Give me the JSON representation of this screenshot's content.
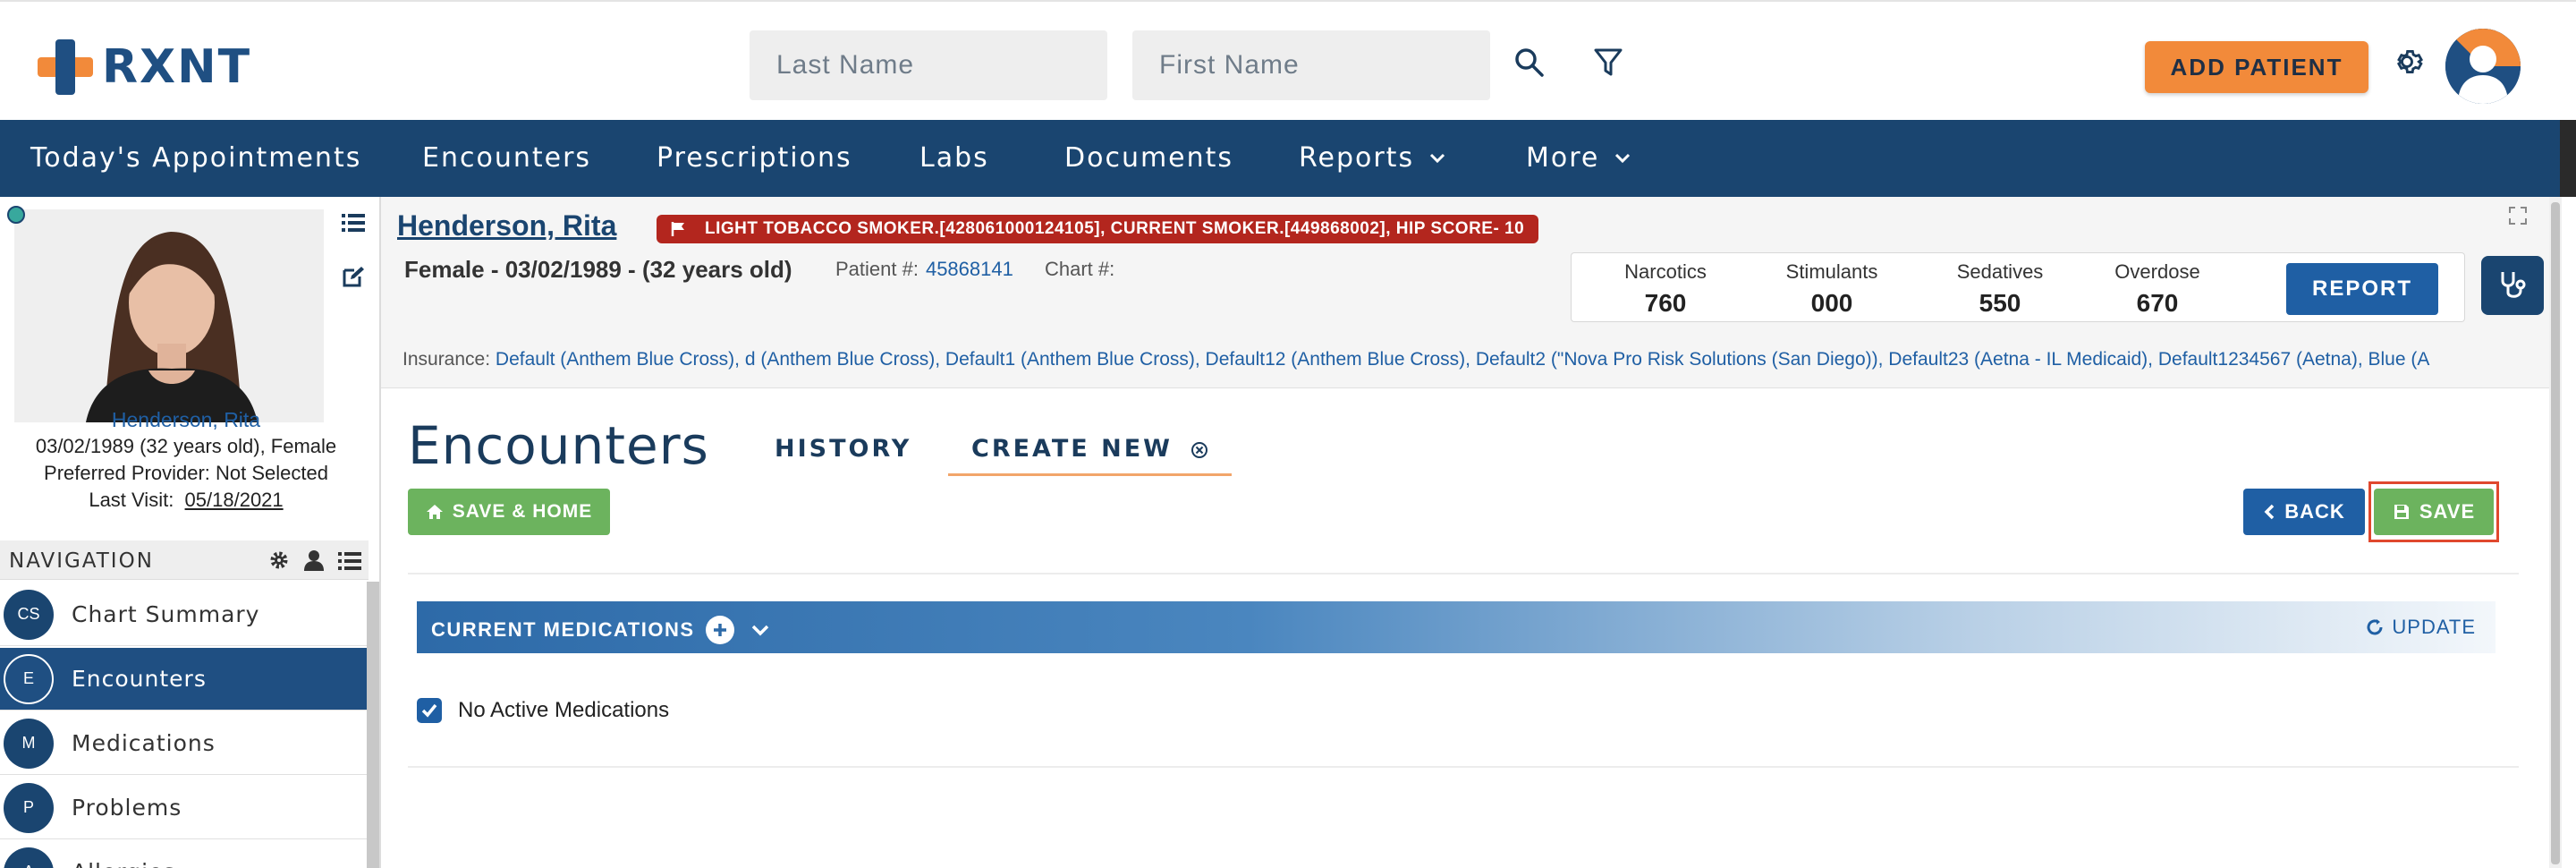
{
  "header": {
    "logo_text": "RXNT",
    "search_last_placeholder": "Last Name",
    "search_first_placeholder": "First Name",
    "add_patient_label": "ADD PATIENT"
  },
  "nav": {
    "items": [
      {
        "label": "Today's Appointments"
      },
      {
        "label": "Encounters"
      },
      {
        "label": "Prescriptions"
      },
      {
        "label": "Labs"
      },
      {
        "label": "Documents"
      },
      {
        "label": "Reports"
      },
      {
        "label": "More"
      }
    ]
  },
  "patient_panel": {
    "name": "Henderson, Rita",
    "dob_line": "03/02/1989 (32 years old), Female",
    "provider_line": "Preferred Provider: Not Selected",
    "last_visit_label": "Last Visit:",
    "last_visit_value": "05/18/2021",
    "navigation_label": "NAVIGATION",
    "items": [
      {
        "badge": "CS",
        "label": "Chart Summary"
      },
      {
        "badge": "E",
        "label": "Encounters"
      },
      {
        "badge": "M",
        "label": "Medications"
      },
      {
        "badge": "P",
        "label": "Problems"
      },
      {
        "badge": "A",
        "label": "Allergies"
      }
    ]
  },
  "patient_header": {
    "name": "Henderson, Rita",
    "alert": "LIGHT TOBACCO SMOKER.[428061000124105], CURRENT SMOKER.[449868002], HIP SCORE- 10",
    "demographics": "Female - 03/02/1989 - (32 years old)",
    "patient_no_label": "Patient #:",
    "patient_no_value": "45868141",
    "chart_no_label": "Chart #:",
    "pdmp": [
      {
        "label": "Narcotics",
        "value": "760"
      },
      {
        "label": "Stimulants",
        "value": "000"
      },
      {
        "label": "Sedatives",
        "value": "550"
      },
      {
        "label": "Overdose",
        "value": "670"
      }
    ],
    "report_label": "REPORT",
    "insurance_label": "Insurance:",
    "insurance_value": "Default (Anthem Blue Cross), d (Anthem Blue Cross), Default1 (Anthem Blue Cross), Default12 (Anthem Blue Cross), Default2 (\"Nova Pro Risk Solutions (San Diego)), Default23 (Aetna - IL Medicaid), Default1234567 (Aetna), Blue (A"
  },
  "encounter": {
    "title": "Encounters",
    "tab_history": "HISTORY",
    "tab_create": "CREATE NEW",
    "save_home_label": "SAVE & HOME",
    "back_label": "BACK",
    "save_label": "SAVE",
    "current_meds_label": "CURRENT MEDICATIONS",
    "update_label": "UPDATE",
    "no_active_meds": "No Active Medications"
  }
}
